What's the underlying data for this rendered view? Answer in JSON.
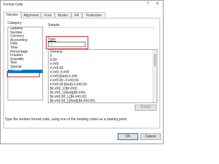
{
  "window": {
    "title": "Format Cells",
    "help_label": "?",
    "close_label": "✕"
  },
  "tabs": [
    {
      "label": "Number"
    },
    {
      "label": "Alignment"
    },
    {
      "label": "Font"
    },
    {
      "label": "Border"
    },
    {
      "label": "Fill"
    },
    {
      "label": "Protection"
    }
  ],
  "category": {
    "label": "Category:",
    "items": [
      "General",
      "Number",
      "Currency",
      "Accounting",
      "Date",
      "Time",
      "Percentage",
      "Fraction",
      "Scientific",
      "Text",
      "Special",
      "Custom"
    ],
    "selected": "Custom"
  },
  "sample": {
    "label": "Sample",
    "value": ""
  },
  "type": {
    "label": "Type:",
    "value": ";;;"
  },
  "codes": [
    "General",
    "0",
    "0.00",
    "#,##0",
    "#,##0.00",
    "#,##0;-#,##0",
    "#,##0;[Red]-#,##0",
    "#,##0.00;-#,##0.00",
    "#,##0.00;[Red]-#,##0.00",
    "$#,##0_);($#,##0)",
    "$#,##0_);[Red]($#,##0)",
    "$#,##0.00_);($#,##0.00)",
    "$#,##0.00_);[Red]($#,##0.00)"
  ],
  "delete_label": "Delete",
  "description": "Type the number format code, using one of the existing codes as a starting point.",
  "buttons": {
    "ok": "OK",
    "cancel": "Cancel"
  },
  "colors": {
    "accent": "#0078d7",
    "highlight": "#d11f1f"
  }
}
